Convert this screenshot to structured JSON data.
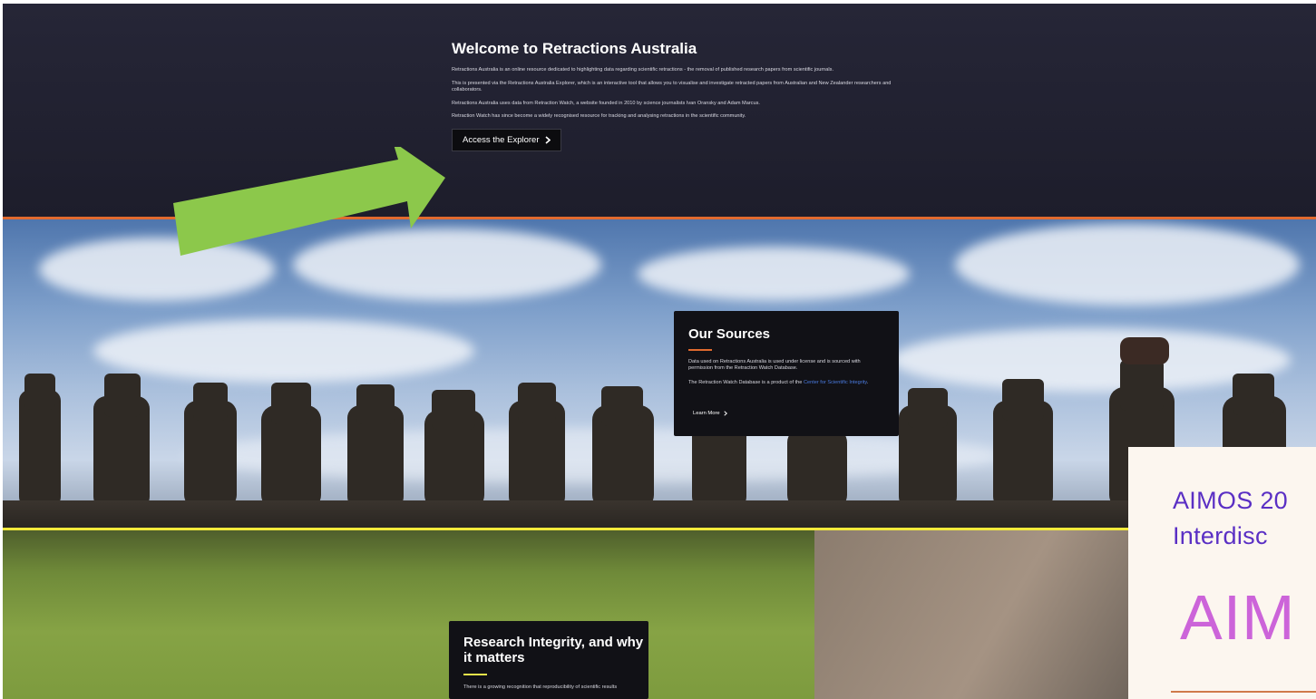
{
  "hero": {
    "title": "Welcome to Retractions Australia",
    "paragraphs": [
      "Retractions Australia is an online resource dedicated to highlighting data regarding scientific retractions - the removal of published research papers from scientific journals.",
      "This is presented via the Retractions Australia Explorer, which is an interactive tool that allows you to visualise and investigate retracted papers from Australian and New Zealander researchers and collaborators.",
      "Retractions Australia uses data from Retraction Watch, a website founded in 2010 by science journalists Ivan Oransky and Adam Marcus.",
      "Retraction Watch has since become a widely recognised resource for tracking and analysing retractions in the scientific community."
    ],
    "cta_label": "Access the Explorer"
  },
  "sources": {
    "title": "Our Sources",
    "p1": "Data used on Retractions Australia is used under license and is sourced with permission from the Retraction Watch Database.",
    "p2_prefix": "The Retraction Watch Database is a product of the ",
    "p2_link": "Center for Scientific Integrity",
    "p2_suffix": ".",
    "learn_more": "Learn More"
  },
  "integrity": {
    "title": "Research Integrity, and why it matters",
    "p1": "There is a growing recognition that reproducibility of scientific results"
  },
  "aimos_overlay": {
    "line1": "AIMOS 20",
    "line2": "Interdisc",
    "big": "AIM"
  },
  "colors": {
    "hero_bg": "#232333",
    "orange_accent": "#e06a2f",
    "yellow_rule": "#f2ea3b",
    "link_blue": "#4a7be0",
    "arrow_green": "#8cc84b",
    "aimos_purple": "#5a2fc4",
    "aimos_pink": "#cc64d9"
  },
  "icons": {
    "cta": "chevron-right-icon",
    "learn_more": "chevron-right-icon",
    "annotation": "arrow-icon"
  }
}
